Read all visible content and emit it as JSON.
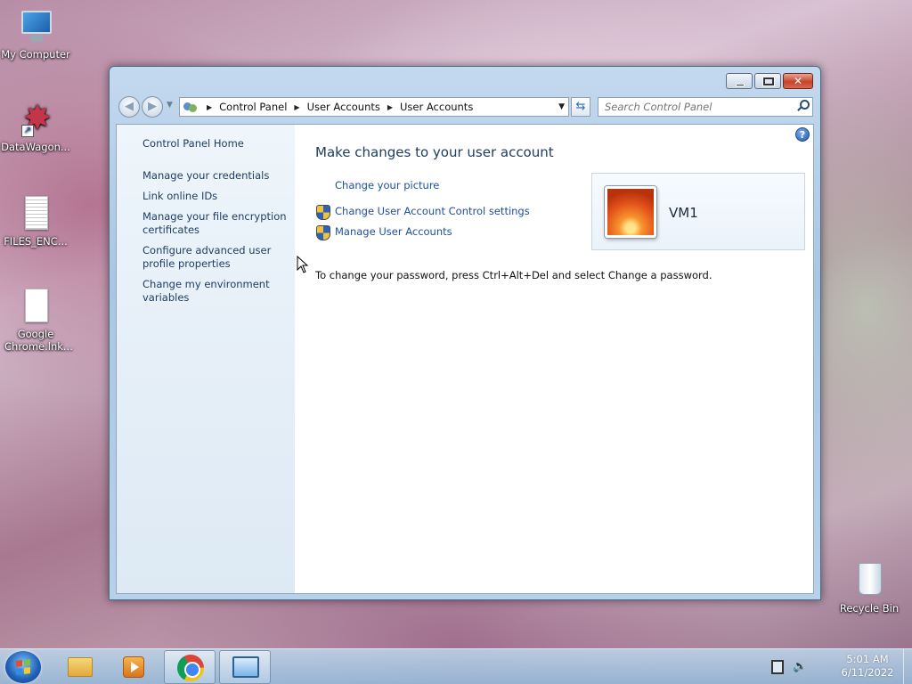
{
  "desktop": {
    "icons": [
      {
        "label": "My Computer",
        "icon": "computer-icon"
      },
      {
        "label": "DataWagon...",
        "icon": "datawagon-shortcut-icon"
      },
      {
        "label": "FILES_ENC...",
        "icon": "text-file-icon"
      },
      {
        "label": "Google Chrome.lnk...",
        "icon": "file-icon"
      },
      {
        "label": "Recycle Bin",
        "icon": "recycle-bin-icon"
      }
    ]
  },
  "window": {
    "breadcrumbs": [
      "Control Panel",
      "User Accounts",
      "User Accounts"
    ],
    "search_placeholder": "Search Control Panel",
    "left_pane": {
      "home": "Control Panel Home",
      "links": [
        [
          "Manage your credentials"
        ],
        [
          "Link online IDs"
        ],
        [
          "Manage your file encryption",
          "certificates"
        ],
        [
          "Configure advanced user",
          "profile properties"
        ],
        [
          "Change my environment",
          "variables"
        ]
      ]
    },
    "main": {
      "title": "Make changes to your user account",
      "tasks": [
        "Change your picture",
        "Change User Account Control settings",
        "Manage User Accounts"
      ],
      "account_name": "VM1",
      "password_note": "To change your password, press Ctrl+Alt+Del and select Change a password."
    }
  },
  "taskbar": {
    "time": "5:01 AM",
    "date": "6/11/2022",
    "pinned": [
      "windows-explorer-icon",
      "media-player-icon",
      "chrome-icon",
      "control-panel-icon"
    ]
  }
}
